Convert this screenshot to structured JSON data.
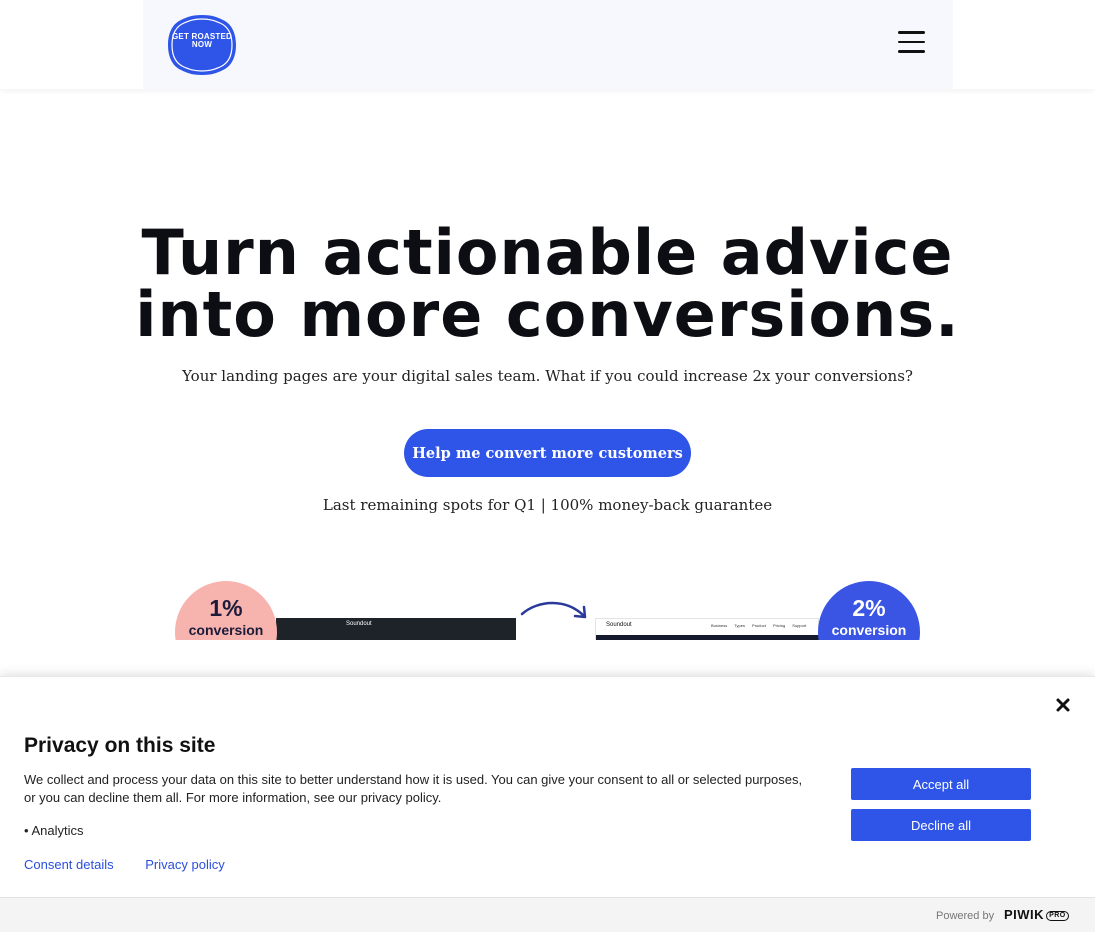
{
  "header": {
    "logo_text": "GET ROASTED NOW",
    "logo_color": "#2f55e8"
  },
  "hero": {
    "title_line1": "Turn actionable advice",
    "title_line2": "into more conversions.",
    "subtitle": "Your landing pages are your digital sales team. What if you could increase 2x your conversions?",
    "cta_label": "Help me convert more customers",
    "note": "Last remaining spots for Q1 | 100% money-back guarantee"
  },
  "showcase": {
    "before_pct": "1%",
    "before_label": "conversion",
    "after_pct": "2%",
    "after_label": "conversion",
    "before_brand": "Soundout",
    "after_brand": "Soundout",
    "after_nav": "Business Types Product Pricing Support"
  },
  "consent": {
    "title": "Privacy on this site",
    "body": "We collect and process your data on this site to better understand how it is used. You can give your consent to all or selected purposes, or you can decline them all. For more information, see our privacy policy.",
    "purposes": [
      "Analytics"
    ],
    "links": {
      "details": "Consent details",
      "policy": "Privacy policy"
    },
    "accept_label": "Accept all",
    "decline_label": "Decline all",
    "powered_by": "Powered by",
    "brand": "PIWIK",
    "brand_badge": "PRO",
    "accent_color": "#2f55e8"
  }
}
